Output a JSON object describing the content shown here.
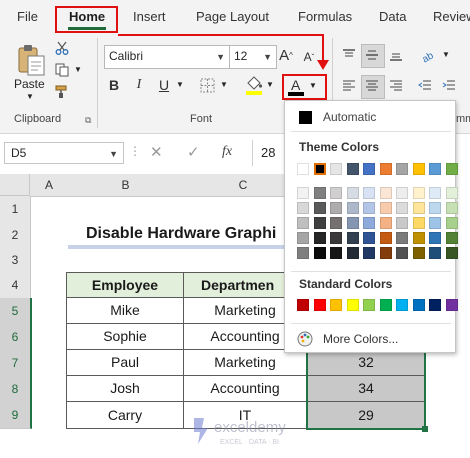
{
  "tabs": [
    "File",
    "Home",
    "Insert",
    "Page Layout",
    "Formulas",
    "Data",
    "Review"
  ],
  "ribbon": {
    "paste_label": "Paste",
    "font_name": "Calibri",
    "font_size": "12",
    "group_clipboard": "Clipboard",
    "group_font": "Font",
    "group_partial": "mm"
  },
  "formula_bar": {
    "name_box": "D5",
    "fx": "fx",
    "value": "28"
  },
  "columns": [
    "A",
    "B",
    "C"
  ],
  "rows": [
    "1",
    "2",
    "3",
    "4",
    "5",
    "6",
    "7",
    "8",
    "9"
  ],
  "sheet": {
    "title": "Disable Hardware Graphi",
    "headers": [
      "Employee",
      "Departmen"
    ],
    "records": [
      {
        "employee": "Mike",
        "department": "Marketing",
        "value": ""
      },
      {
        "employee": "Sophie",
        "department": "Accounting",
        "value": ""
      },
      {
        "employee": "Paul",
        "department": "Marketing",
        "value": "32"
      },
      {
        "employee": "Josh",
        "department": "Accounting",
        "value": "34"
      },
      {
        "employee": "Carry",
        "department": "IT",
        "value": "29"
      }
    ]
  },
  "color_dropdown": {
    "automatic_label": "Automatic",
    "theme_label": "Theme Colors",
    "standard_label": "Standard Colors",
    "more_colors_label": "More Colors...",
    "theme_top": [
      "#ffffff",
      "#000000",
      "#e7e6e6",
      "#44546a",
      "#4472c4",
      "#ed7d31",
      "#a5a5a5",
      "#ffc000",
      "#5b9bd5",
      "#70ad47"
    ],
    "theme_shades": [
      [
        "#f2f2f2",
        "#7f7f7f",
        "#d0cece",
        "#d6dce4",
        "#d9e2f3",
        "#fbe5d5",
        "#ededed",
        "#fff2cc",
        "#deebf6",
        "#e2efd9"
      ],
      [
        "#d8d8d8",
        "#595959",
        "#aeabab",
        "#adb9ca",
        "#b4c6e7",
        "#f7cbac",
        "#dbdbdb",
        "#ffe599",
        "#bdd7ee",
        "#c5e0b3"
      ],
      [
        "#bfbfbf",
        "#3f3f3f",
        "#757070",
        "#8496b0",
        "#8eaadb",
        "#f4b183",
        "#c9c9c9",
        "#ffd965",
        "#9dc3e6",
        "#a8d08d"
      ],
      [
        "#a5a5a5",
        "#262626",
        "#3a3838",
        "#323f4f",
        "#2f5496",
        "#c55a11",
        "#7b7b7b",
        "#bf9000",
        "#2e75b5",
        "#538135"
      ],
      [
        "#7f7f7f",
        "#0c0c0c",
        "#161616",
        "#222a35",
        "#1f3864",
        "#833c0b",
        "#525252",
        "#7f6000",
        "#1f4e79",
        "#375623"
      ]
    ],
    "standard": [
      "#c00000",
      "#ff0000",
      "#ffc000",
      "#ffff00",
      "#92d050",
      "#00b050",
      "#00b0f0",
      "#0070c0",
      "#002060",
      "#7030a0"
    ]
  },
  "watermark": {
    "name": "exceldemy",
    "tagline": "EXCEL · DATA · BI"
  }
}
